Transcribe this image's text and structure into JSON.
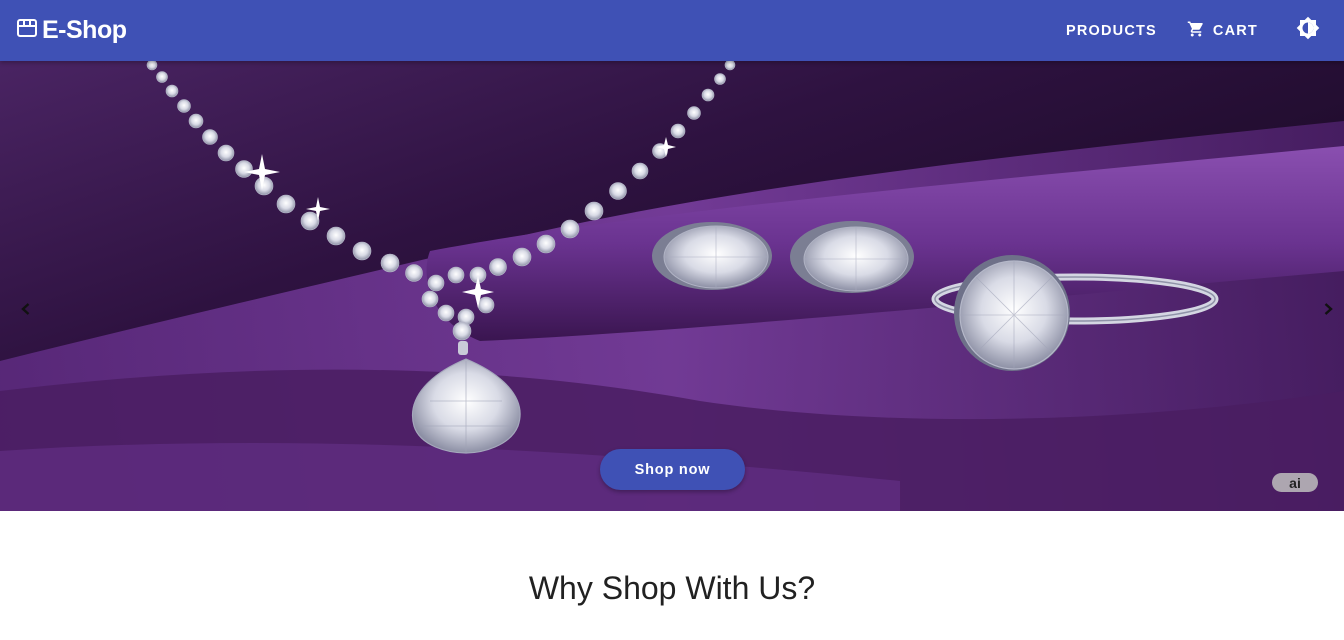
{
  "app": {
    "brand_title": "E-Shop",
    "brand_icon": "storefront-icon"
  },
  "nav": {
    "products_label": "PRODUCTS",
    "cart_label": "CART",
    "cart_icon": "cart-icon",
    "theme_icon": "brightness-toggle-icon"
  },
  "hero": {
    "cta_label": "Shop now",
    "badge_label": "ai",
    "prev_icon": "chevron-left-icon",
    "next_icon": "chevron-right-icon"
  },
  "section": {
    "heading": "Why Shop With Us?"
  },
  "colors": {
    "primary": "#3f51b5",
    "velvet": "#5a2a7a",
    "text": "#212121"
  }
}
